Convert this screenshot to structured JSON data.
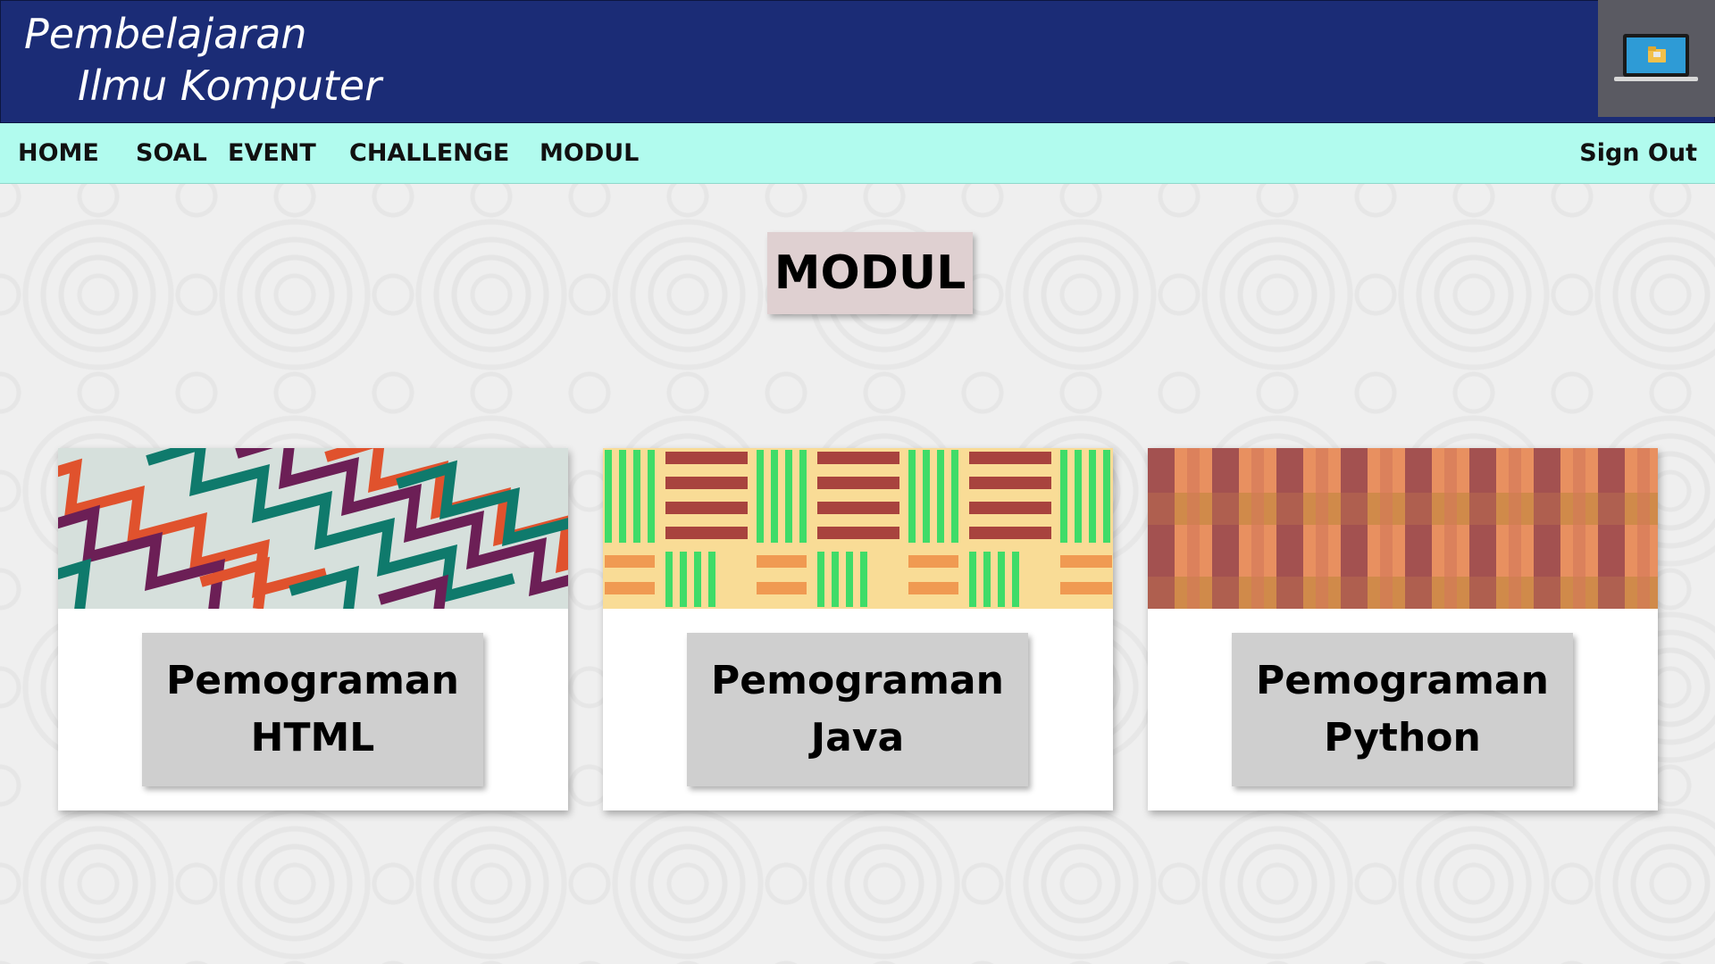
{
  "header": {
    "title_line1": "Pembelajaran",
    "title_line2": "Ilmu Komputer",
    "logo_icon": "laptop-folder-icon",
    "background_color": "#1b2c76"
  },
  "nav": {
    "background_color": "#b1fbee",
    "items": [
      {
        "label": "HOME"
      },
      {
        "label": "SOAL"
      },
      {
        "label": "EVENT"
      },
      {
        "label": "CHALLENGE"
      },
      {
        "label": "MODUL"
      }
    ],
    "sign_out": "Sign Out"
  },
  "page": {
    "heading": "MODUL"
  },
  "modules": [
    {
      "line1": "Pemograman",
      "line2": "HTML",
      "banner": "zigzag-pattern"
    },
    {
      "line1": "Pemograman",
      "line2": "Java",
      "banner": "kente-stripe-pattern"
    },
    {
      "line1": "Pemograman",
      "line2": "Python",
      "banner": "plaid-pattern"
    }
  ]
}
